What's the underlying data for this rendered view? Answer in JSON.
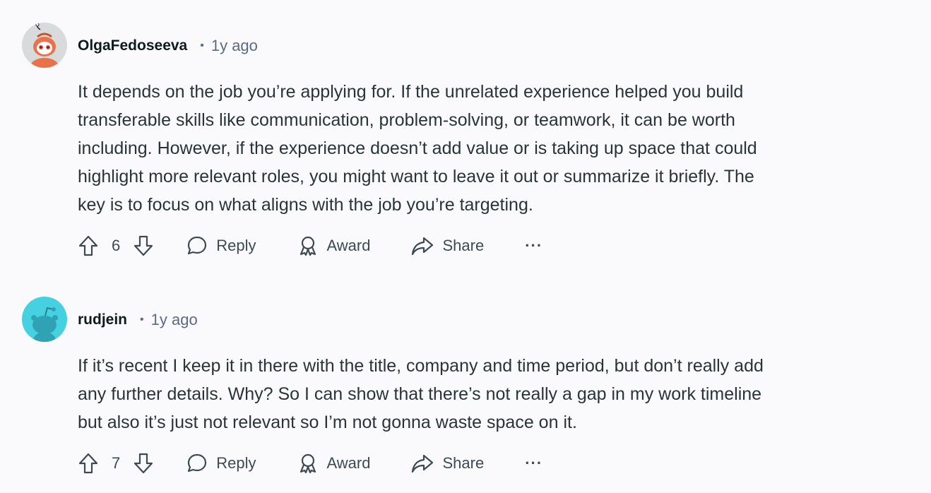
{
  "comments": [
    {
      "username": "OlgaFedoseeva",
      "separator": "•",
      "time": "1y ago",
      "body_lines": [
        "It depends on the job you’re applying for. If the unrelated experience helped you build",
        "transferable skills like communication, problem-solving, or teamwork, it can be worth",
        "including. However, if the experience doesn’t add value or is taking up space that could",
        "highlight more relevant roles, you might want to leave it out or summarize it briefly. The",
        "key is to focus on what aligns with the job you’re targeting."
      ],
      "score": "6",
      "avatar_color": "#e8734a"
    },
    {
      "username": "rudjein",
      "separator": "•",
      "time": "1y ago",
      "body_lines": [
        "If it’s recent I keep it in there with the title, company and time period, but don’t really add",
        "any further details. Why? So I can show that there’s not really a gap in my work timeline",
        "but also it’s just not relevant so I’m not gonna waste space on it."
      ],
      "score": "7",
      "avatar_color": "#46d1e0"
    }
  ],
  "actions": {
    "reply_label": "Reply",
    "award_label": "Award",
    "share_label": "Share",
    "more_label": "···"
  },
  "icons": {
    "upvote": "upvote-arrow-icon",
    "downvote": "downvote-arrow-icon",
    "reply": "speech-bubble-icon",
    "award": "award-ribbon-icon",
    "share": "share-arrow-icon",
    "more": "ellipsis-icon"
  },
  "colors": {
    "background": "#fafafc",
    "meta_text": "#5a6b86",
    "action_text": "#3d4a52"
  }
}
